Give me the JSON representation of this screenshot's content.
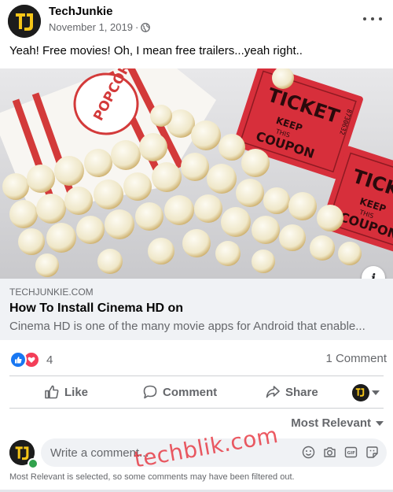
{
  "post": {
    "page_name": "TechJunkie",
    "date": "November 1, 2019",
    "date_separator": "·",
    "text": "Yeah!  Free movies!  Oh, I mean free trailers...yeah right.."
  },
  "image": {
    "popcorn_bag_text": "POPCORN",
    "ticket_1": {
      "title": "TICKET",
      "keep": "KEEP",
      "this": "THIS",
      "coupon": "COUPON",
      "serial": "8730632"
    },
    "ticket_2": {
      "title": "TICKET",
      "keep": "KEEP",
      "this": "THIS",
      "coupon": "COUPON"
    }
  },
  "link_preview": {
    "domain": "TECHJUNKIE.COM",
    "title": "How To Install Cinema HD on",
    "description": "Cinema HD is one of the many movie apps for Android that enable..."
  },
  "stats": {
    "reaction_count": "4",
    "comment_count": "1 Comment"
  },
  "actions": {
    "like": "Like",
    "comment": "Comment",
    "share": "Share"
  },
  "comments": {
    "sort_label": "Most Relevant",
    "placeholder": "Write a comment...",
    "filter_note": "Most Relevant is selected, so some comments may have been filtered out."
  },
  "watermark": "techblik.com",
  "icons": {
    "more": "more-options-icon",
    "privacy": "globe-icon",
    "info": "info-icon",
    "reactions": [
      "like-reaction-icon",
      "love-reaction-icon"
    ],
    "composer": [
      "emoji-icon",
      "camera-icon",
      "gif-icon",
      "sticker-icon"
    ]
  },
  "colors": {
    "accent": "#1877f2",
    "love": "#f33e58",
    "secondary_text": "#65676b",
    "card_bg": "#f0f2f5",
    "ticket_red": "#d72f3b",
    "logo_yellow": "#f5c518"
  }
}
